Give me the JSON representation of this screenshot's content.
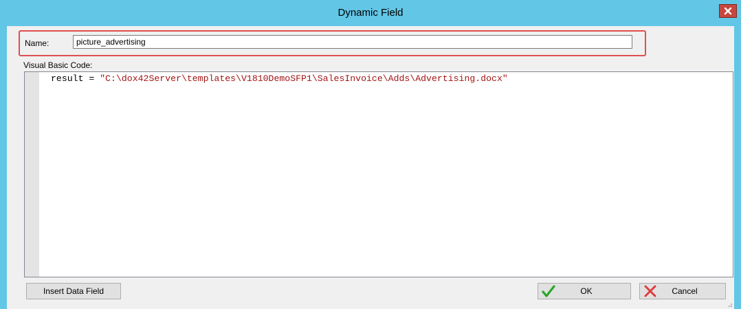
{
  "window": {
    "title": "Dynamic Field",
    "close_icon": "close-icon"
  },
  "form": {
    "name_label": "Name:",
    "name_value": "picture_advertising",
    "vb_label": "Visual Basic Code:"
  },
  "code": {
    "prefix": "result = ",
    "string": "\"C:\\dox42Server\\templates\\V1810DemoSFP1\\SalesInvoice\\Adds\\Advertising.docx\""
  },
  "buttons": {
    "insert_label": "Insert Data Field",
    "ok_label": "OK",
    "ok_icon": "checkmark-icon",
    "cancel_label": "Cancel",
    "cancel_icon": "x-icon"
  },
  "colors": {
    "titlebar": "#62c6e6",
    "highlight": "#e04e4e",
    "ok_check": "#2aa52a",
    "cancel_x": "#e03c3c",
    "code_string": "#a31515"
  }
}
